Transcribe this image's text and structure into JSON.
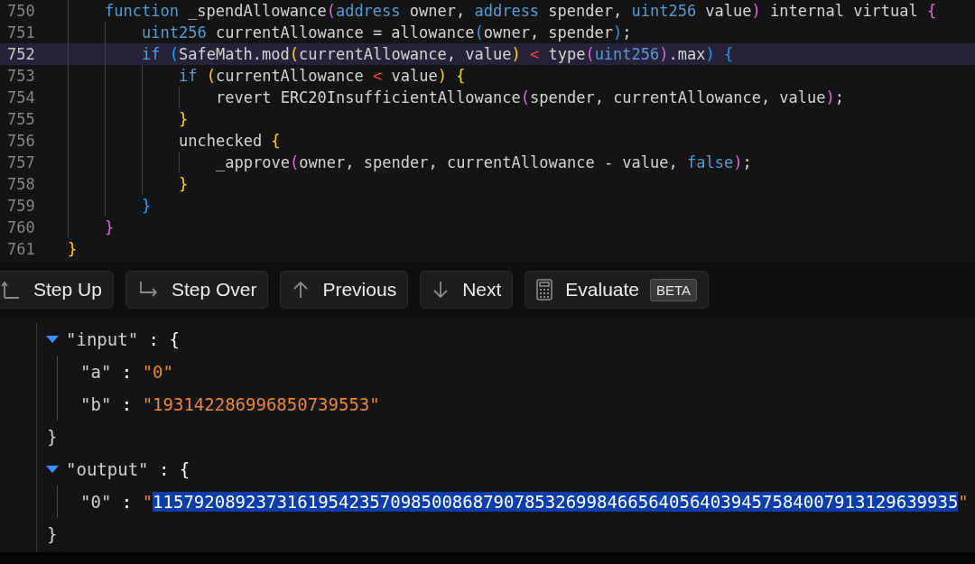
{
  "code": {
    "lines": [
      {
        "children": [
          {
            "number": "750",
            "current": false,
            "tokens": [
              {
                "text": "function",
                "kind": "keyword"
              },
              {
                "text": " _spendAllowance",
                "kind": "plain"
              },
              {
                "text": "(",
                "kind": "bracket2"
              },
              {
                "text": "address",
                "kind": "keyword"
              },
              {
                "text": " owner, ",
                "kind": "plain"
              },
              {
                "text": "address",
                "kind": "keyword"
              },
              {
                "text": " spender, ",
                "kind": "plain"
              },
              {
                "text": "uint256",
                "kind": "keyword"
              },
              {
                "text": " value",
                "kind": "plain"
              },
              {
                "text": ")",
                "kind": "bracket2"
              },
              {
                "text": " internal virtual ",
                "kind": "plain"
              },
              {
                "text": "{",
                "kind": "bracket2"
              }
            ],
            "children": [
              {
                "number": "751",
                "current": false,
                "tokens": [
                  {
                    "text": "uint256",
                    "kind": "keyword"
                  },
                  {
                    "text": " currentAllowance = allowance",
                    "kind": "plain"
                  },
                  {
                    "text": "(",
                    "kind": "bracket3"
                  },
                  {
                    "text": "owner, spender",
                    "kind": "plain"
                  },
                  {
                    "text": ")",
                    "kind": "bracket3"
                  },
                  {
                    "text": ";",
                    "kind": "plain"
                  }
                ]
              },
              {
                "number": "752",
                "current": true,
                "tokens": [
                  {
                    "text": "if",
                    "kind": "keyword"
                  },
                  {
                    "text": " (",
                    "kind": "bracket3"
                  },
                  {
                    "text": "SafeMath.mod",
                    "kind": "plain"
                  },
                  {
                    "text": "(",
                    "kind": "bracket1"
                  },
                  {
                    "text": "currentAllowance, value",
                    "kind": "plain"
                  },
                  {
                    "text": ")",
                    "kind": "bracket1"
                  },
                  {
                    "text": " <",
                    "kind": "operator"
                  },
                  {
                    "text": " type",
                    "kind": "plain"
                  },
                  {
                    "text": "(",
                    "kind": "bracket2"
                  },
                  {
                    "text": "uint256",
                    "kind": "keyword"
                  },
                  {
                    "text": ")",
                    "kind": "bracket2"
                  },
                  {
                    "text": ".max",
                    "kind": "plain"
                  },
                  {
                    "text": ")",
                    "kind": "bracket3"
                  },
                  {
                    "text": " {",
                    "kind": "bracket3"
                  }
                ],
                "children": [
                  {
                    "number": "753",
                    "current": false,
                    "tokens": [
                      {
                        "text": "if",
                        "kind": "keyword"
                      },
                      {
                        "text": " (",
                        "kind": "bracket1"
                      },
                      {
                        "text": "currentAllowance ",
                        "kind": "plain"
                      },
                      {
                        "text": "<",
                        "kind": "operator"
                      },
                      {
                        "text": " value",
                        "kind": "plain"
                      },
                      {
                        "text": ")",
                        "kind": "bracket1"
                      },
                      {
                        "text": " {",
                        "kind": "bracket1"
                      }
                    ],
                    "children": [
                      {
                        "number": "754",
                        "current": false,
                        "tokens": [
                          {
                            "text": "revert ERC20InsufficientAllowance",
                            "kind": "plain"
                          },
                          {
                            "text": "(",
                            "kind": "bracket2"
                          },
                          {
                            "text": "spender, currentAllowance, value",
                            "kind": "plain"
                          },
                          {
                            "text": ")",
                            "kind": "bracket2"
                          },
                          {
                            "text": ";",
                            "kind": "plain"
                          }
                        ]
                      }
                    ]
                  },
                  {
                    "number": "755",
                    "current": false,
                    "tokens": [
                      {
                        "text": "}",
                        "kind": "bracket1"
                      }
                    ]
                  },
                  {
                    "number": "756",
                    "current": false,
                    "tokens": [
                      {
                        "text": "unchecked ",
                        "kind": "plain"
                      },
                      {
                        "text": "{",
                        "kind": "bracket1"
                      }
                    ],
                    "children": [
                      {
                        "number": "757",
                        "current": false,
                        "tokens": [
                          {
                            "text": "_approve",
                            "kind": "plain"
                          },
                          {
                            "text": "(",
                            "kind": "bracket2"
                          },
                          {
                            "text": "owner, spender, currentAllowance - value, ",
                            "kind": "plain"
                          },
                          {
                            "text": "false",
                            "kind": "keyword"
                          },
                          {
                            "text": ")",
                            "kind": "bracket2"
                          },
                          {
                            "text": ";",
                            "kind": "plain"
                          }
                        ]
                      }
                    ]
                  },
                  {
                    "number": "758",
                    "current": false,
                    "tokens": [
                      {
                        "text": "}",
                        "kind": "bracket1"
                      }
                    ]
                  }
                ]
              },
              {
                "number": "759",
                "current": false,
                "tokens": [
                  {
                    "text": "}",
                    "kind": "bracket3"
                  }
                ]
              }
            ]
          },
          {
            "number": "760",
            "current": false,
            "tokens": [
              {
                "text": "}",
                "kind": "bracket2"
              }
            ]
          }
        ]
      },
      {
        "number": "761",
        "current": false,
        "tokens": [
          {
            "text": "}",
            "kind": "bracket1"
          }
        ]
      }
    ]
  },
  "toolbar": {
    "buttons": [
      {
        "label": "Step Up",
        "kind": "step-up"
      },
      {
        "label": "Step Over",
        "kind": "step-over"
      },
      {
        "label": "Previous",
        "kind": "previous"
      },
      {
        "label": "Next",
        "kind": "next"
      },
      {
        "label": "Evaluate",
        "kind": "evaluate",
        "badge": "BETA"
      }
    ]
  },
  "tree": {
    "children": [
      {
        "expanded": true,
        "tokens": [
          {
            "text": "\"input\"",
            "kind": "key"
          },
          {
            "text": " : ",
            "kind": "punct"
          },
          {
            "text": "{",
            "kind": "punct"
          }
        ],
        "close": "}",
        "children": [
          {
            "tokens": [
              {
                "text": "\"a\"",
                "kind": "key"
              },
              {
                "text": " : ",
                "kind": "punct"
              },
              {
                "text": "\"0\"",
                "kind": "string"
              }
            ]
          },
          {
            "tokens": [
              {
                "text": "\"b\"",
                "kind": "key"
              },
              {
                "text": " : ",
                "kind": "punct"
              },
              {
                "text": "\"193142286996850739553\"",
                "kind": "string"
              }
            ]
          }
        ]
      },
      {
        "expanded": true,
        "tokens": [
          {
            "text": "\"output\"",
            "kind": "key"
          },
          {
            "text": " : ",
            "kind": "punct"
          },
          {
            "text": "{",
            "kind": "punct"
          }
        ],
        "close": "}",
        "children": [
          {
            "tokens": [
              {
                "text": "\"0\"",
                "kind": "key"
              },
              {
                "text": " : ",
                "kind": "punct"
              },
              {
                "text": "\"",
                "kind": "string"
              },
              {
                "text": "115792089237316195423570985008687907853269984665640564039457584007913129639935",
                "kind": "selection"
              },
              {
                "text": "\"",
                "kind": "string"
              }
            ]
          }
        ]
      }
    ]
  }
}
